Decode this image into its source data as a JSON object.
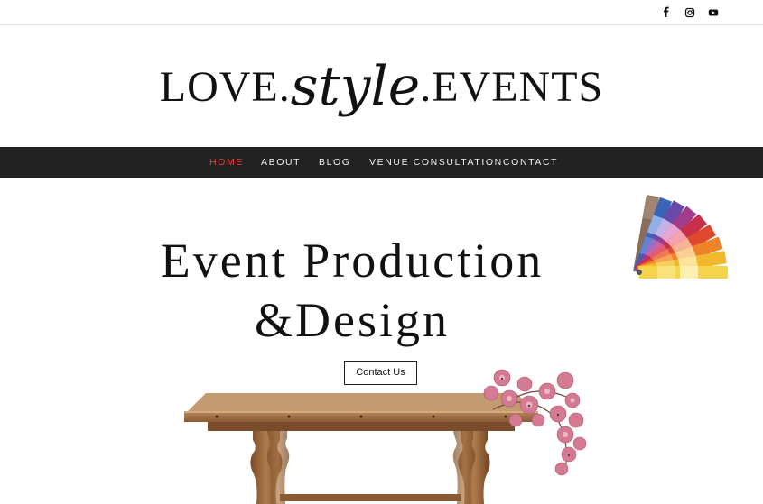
{
  "topbar": {
    "social_icons": [
      "facebook-icon",
      "instagram-icon",
      "youtube-icon"
    ]
  },
  "logo": {
    "part1": "LOVE.",
    "part2": "style",
    "part3": ".EVENTS"
  },
  "nav": {
    "items": [
      {
        "label": "HOME",
        "active": true
      },
      {
        "label": "ABOUT",
        "active": false
      },
      {
        "label": "BLOG",
        "active": false
      },
      {
        "label": "VENUE CONSULTATION",
        "active": false
      },
      {
        "label": "CONTACT",
        "active": false
      }
    ]
  },
  "hero": {
    "line1": "Event Production",
    "line2": "&Design",
    "cta_label": "Contact Us"
  },
  "colors": {
    "nav_bg": "#222222",
    "nav_active": "#e0453f",
    "nav_text": "#f0f0f0"
  }
}
